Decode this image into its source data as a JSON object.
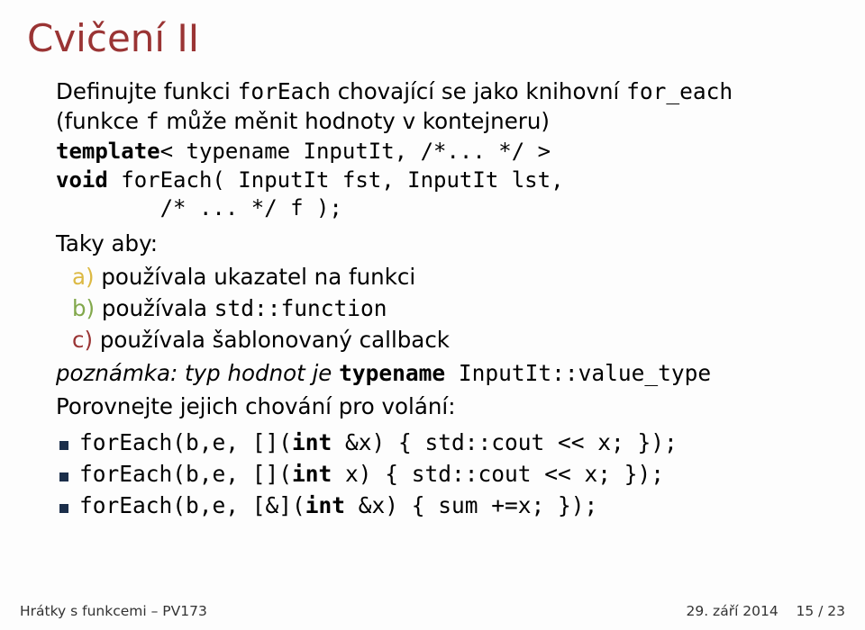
{
  "title": "Cvičení II",
  "intro": {
    "pre": "Definujte funkci ",
    "code1": "forEach",
    "mid1": " chovající se jako knihovní ",
    "code2": "for_each",
    "line2a": "(funkce ",
    "code3": "f",
    "line2b": " může měnit hodnoty v kontejneru)"
  },
  "sig": {
    "kw1": "template",
    "l1": "< typename InputIt, /*... */ >",
    "kw2": "void",
    "l2": " forEach( InputIt fst, InputIt lst,",
    "l3": "        /* ... */ f );"
  },
  "taky": "Taky aby:",
  "items": {
    "a": {
      "label": "a)",
      "text": " používala ukazatel na funkci"
    },
    "b": {
      "label": "b)",
      "pre": " používala ",
      "code": "std::function"
    },
    "c": {
      "label": "c)",
      "text": " používala šablonovaný callback"
    }
  },
  "note": {
    "pre": "poznámka: typ hodnot je ",
    "kw": "typename",
    "code": " InputIt::value_type"
  },
  "compare": "Porovnejte jejich chování pro volání:",
  "bullets": [
    {
      "a": "forEach(b,e, [](",
      "kw": "int",
      "b": " &x) { std::cout << x; });"
    },
    {
      "a": "forEach(b,e, [](",
      "kw": "int",
      "b": " x) { std::cout << x; });"
    },
    {
      "a": "forEach(b,e, [&](",
      "kw": "int",
      "b": " &x) { sum +=x; });"
    }
  ],
  "footer": {
    "left": "Hrátky s funkcemi – PV173",
    "date": "29. září 2014",
    "page": "15 / 23"
  }
}
